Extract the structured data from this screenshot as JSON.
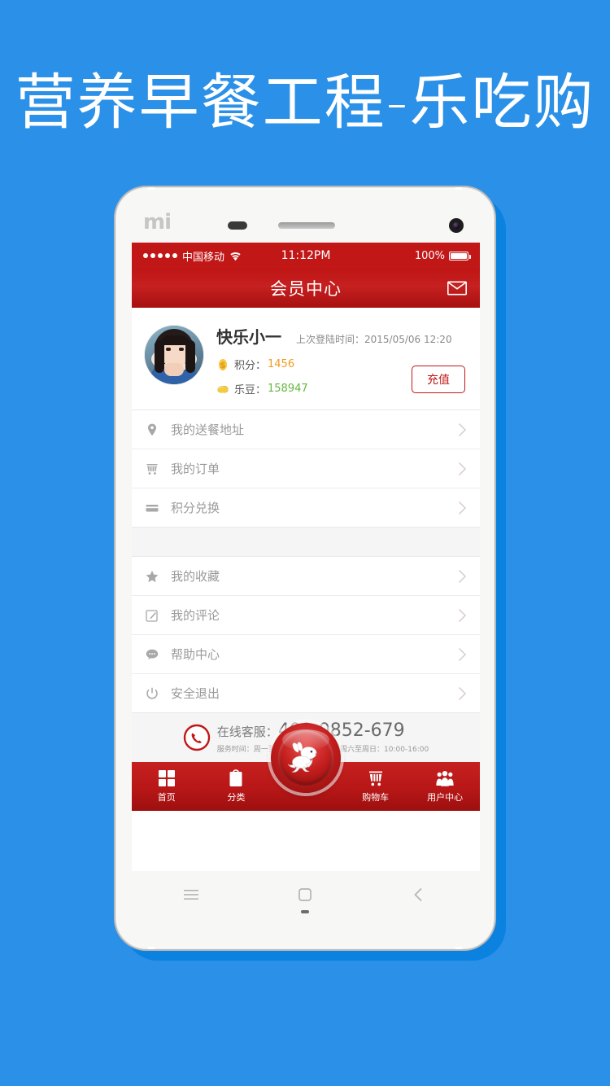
{
  "headline": "营养早餐工程-乐吃购",
  "colors": {
    "background_blue": "#2a90e8",
    "shadow_blue": "#0b82e0",
    "brand_red": "#c11717",
    "points_orange": "#f29b1d",
    "beans_green": "#63b83e",
    "list_gray": "#f5f5f5"
  },
  "phone": {
    "brand_logo": "mi",
    "hardware": {
      "proximity_sensor": "sensor-dot",
      "earpiece": "earpiece-speaker",
      "front_camera": "front-camera"
    },
    "android_nav": {
      "menu": "menu-icon",
      "home": "home-icon",
      "back": "back-icon",
      "mic": "microphone-slot"
    }
  },
  "statusbar": {
    "signal_dots": 5,
    "carrier": "中国移动",
    "wifi": "wifi-icon",
    "time": "11:12PM",
    "battery_percent": "100%",
    "battery": "battery-icon"
  },
  "navbar": {
    "title": "会员中心",
    "mail_icon": "envelope-icon"
  },
  "profile": {
    "avatar": "user-avatar-photo",
    "username": "快乐小一",
    "last_login_label": "上次登陆时间：",
    "last_login_value": "2015/05/06  12:20",
    "points": {
      "icon": "dollar-coin-icon",
      "label": "积分：",
      "value": "1456"
    },
    "beans": {
      "icon": "bean-coin-icon",
      "label": "乐豆：",
      "value": "158947"
    },
    "recharge_button": "充值"
  },
  "menu_group_1": [
    {
      "icon": "location-pin-icon",
      "label": "我的送餐地址",
      "chevron": "chevron-right-icon"
    },
    {
      "icon": "shopping-cart-icon",
      "label": "我的订单",
      "chevron": "chevron-right-icon"
    },
    {
      "icon": "credit-card-icon",
      "label": "积分兑换",
      "chevron": "chevron-right-icon"
    }
  ],
  "menu_group_2": [
    {
      "icon": "star-icon",
      "label": "我的收藏",
      "chevron": "chevron-right-icon"
    },
    {
      "icon": "edit-pencil-icon",
      "label": "我的评论",
      "chevron": "chevron-right-icon"
    },
    {
      "icon": "chat-bubble-icon",
      "label": "帮助中心",
      "chevron": "chevron-right-icon"
    },
    {
      "icon": "power-icon",
      "label": "安全退出",
      "chevron": "chevron-right-icon"
    }
  ],
  "service": {
    "phone_icon": "phone-call-icon",
    "label": "在线客服：",
    "number": "400-0852-679",
    "hours": "服务时间：周一至周五：9:30-19:30 周六至周日：10:00-16:00"
  },
  "tabbar": {
    "items": [
      {
        "icon": "grid-icon",
        "label": "首页"
      },
      {
        "icon": "clipboard-icon",
        "label": "分类"
      },
      {
        "icon": "shopping-cart-icon",
        "label": "购物车"
      },
      {
        "icon": "users-icon",
        "label": "用户中心"
      }
    ],
    "center_button": "rabbit-logo-button"
  }
}
